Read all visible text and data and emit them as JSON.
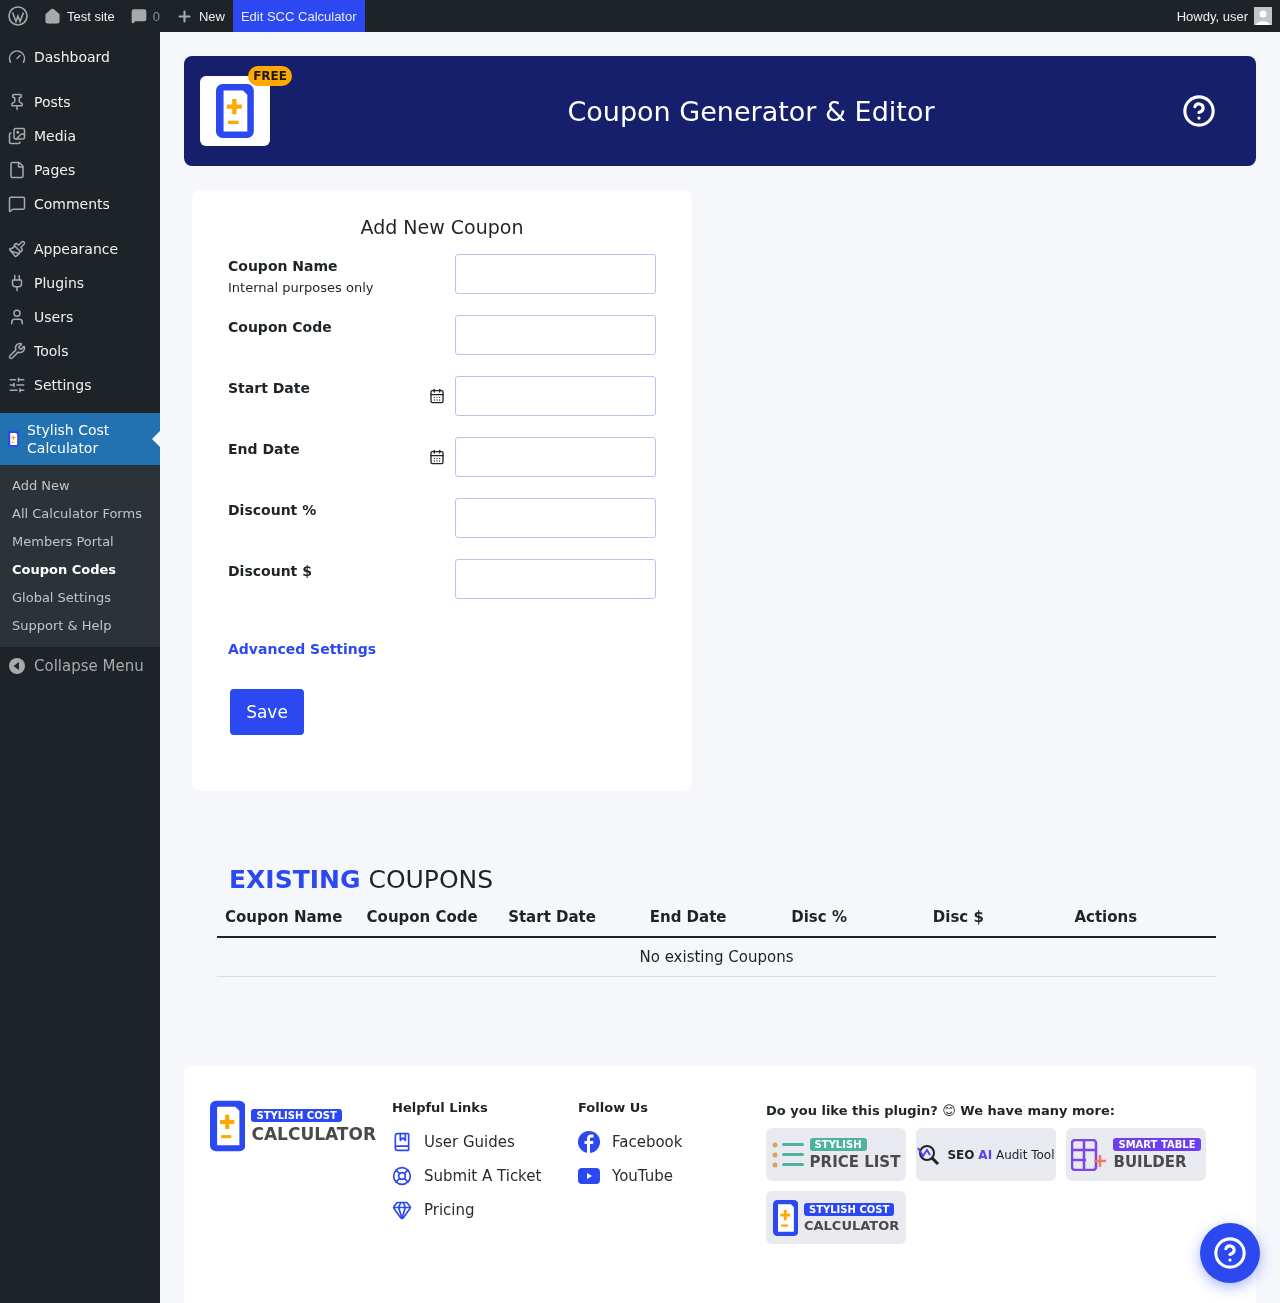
{
  "admin_bar": {
    "site": "Test site",
    "comments": "0",
    "new": "New",
    "items": [
      {
        "label": "Edit SCC Calculator",
        "selected": true
      }
    ],
    "greeting": "Howdy, user"
  },
  "sidebar": {
    "sections": [
      [
        {
          "label": "Dashboard",
          "selected": false
        }
      ],
      [
        {
          "label": "Posts",
          "selected": false
        },
        {
          "label": "Media",
          "selected": false
        },
        {
          "label": "Pages",
          "selected": false
        },
        {
          "label": "Comments",
          "selected": false
        }
      ],
      [
        {
          "label": "Appearance",
          "selected": false
        },
        {
          "label": "Plugins",
          "selected": false
        },
        {
          "label": "Users",
          "selected": false
        },
        {
          "label": "Tools",
          "selected": false
        },
        {
          "label": "Settings",
          "selected": false
        }
      ],
      [
        {
          "label": "Stylish Cost Calculator",
          "selected": true
        }
      ]
    ],
    "submenu": [
      {
        "label": "Add New",
        "selected": false
      },
      {
        "label": "All Calculator Forms",
        "selected": false
      },
      {
        "label": "Members Portal",
        "selected": false
      },
      {
        "label": "Coupon Codes",
        "selected": true
      },
      {
        "label": "Global Settings",
        "selected": false
      },
      {
        "label": "Support & Help",
        "selected": false
      }
    ],
    "collapse": "Collapse Menu"
  },
  "header": {
    "badge": "FREE",
    "title": "Coupon Generator & Editor"
  },
  "form": {
    "title": "Add New Coupon",
    "fields": [
      {
        "label": "Coupon Name",
        "hint": "Internal purposes only",
        "kind": "text"
      },
      {
        "label": "Coupon Code",
        "kind": "text"
      },
      {
        "label": "Start Date",
        "kind": "date"
      },
      {
        "label": "End Date",
        "kind": "date"
      },
      {
        "label": "Discount %",
        "kind": "text"
      },
      {
        "label": "Discount $",
        "kind": "text"
      }
    ],
    "advanced": "Advanced Settings",
    "save": "Save"
  },
  "existing": {
    "title_accent": "EXISTING",
    "title_rest": "COUPONS",
    "columns": [
      "Coupon Name",
      "Coupon Code",
      "Start Date",
      "End Date",
      "Disc %",
      "Disc $",
      "Actions"
    ],
    "empty": "No existing Coupons"
  },
  "footer": {
    "logo_badge": "STYLISH COST",
    "logo_title": "CALCULATOR",
    "helpful": {
      "title": "Helpful Links",
      "links": [
        {
          "label": "User Guides",
          "kind": "book"
        },
        {
          "label": "Submit A Ticket",
          "kind": "lifebuoy"
        },
        {
          "label": "Pricing",
          "kind": "gem"
        }
      ]
    },
    "follow": {
      "title": "Follow Us",
      "links": [
        {
          "label": "Facebook",
          "kind": "facebook"
        },
        {
          "label": "YouTube",
          "kind": "youtube"
        }
      ]
    },
    "promo": "Do you like this plugin? 😊 We have many more:",
    "products": [
      {
        "kind": "list",
        "badge": "STYLISH",
        "title": "PRICE LIST"
      },
      {
        "kind": "seo",
        "parts": [
          "SEO",
          "AI",
          "Audit Tool"
        ]
      },
      {
        "kind": "table",
        "badge": "SMART TABLE",
        "title": "BUILDER"
      },
      {
        "kind": "calc",
        "badge": "STYLISH COST",
        "title": "CALCULATOR"
      }
    ]
  }
}
